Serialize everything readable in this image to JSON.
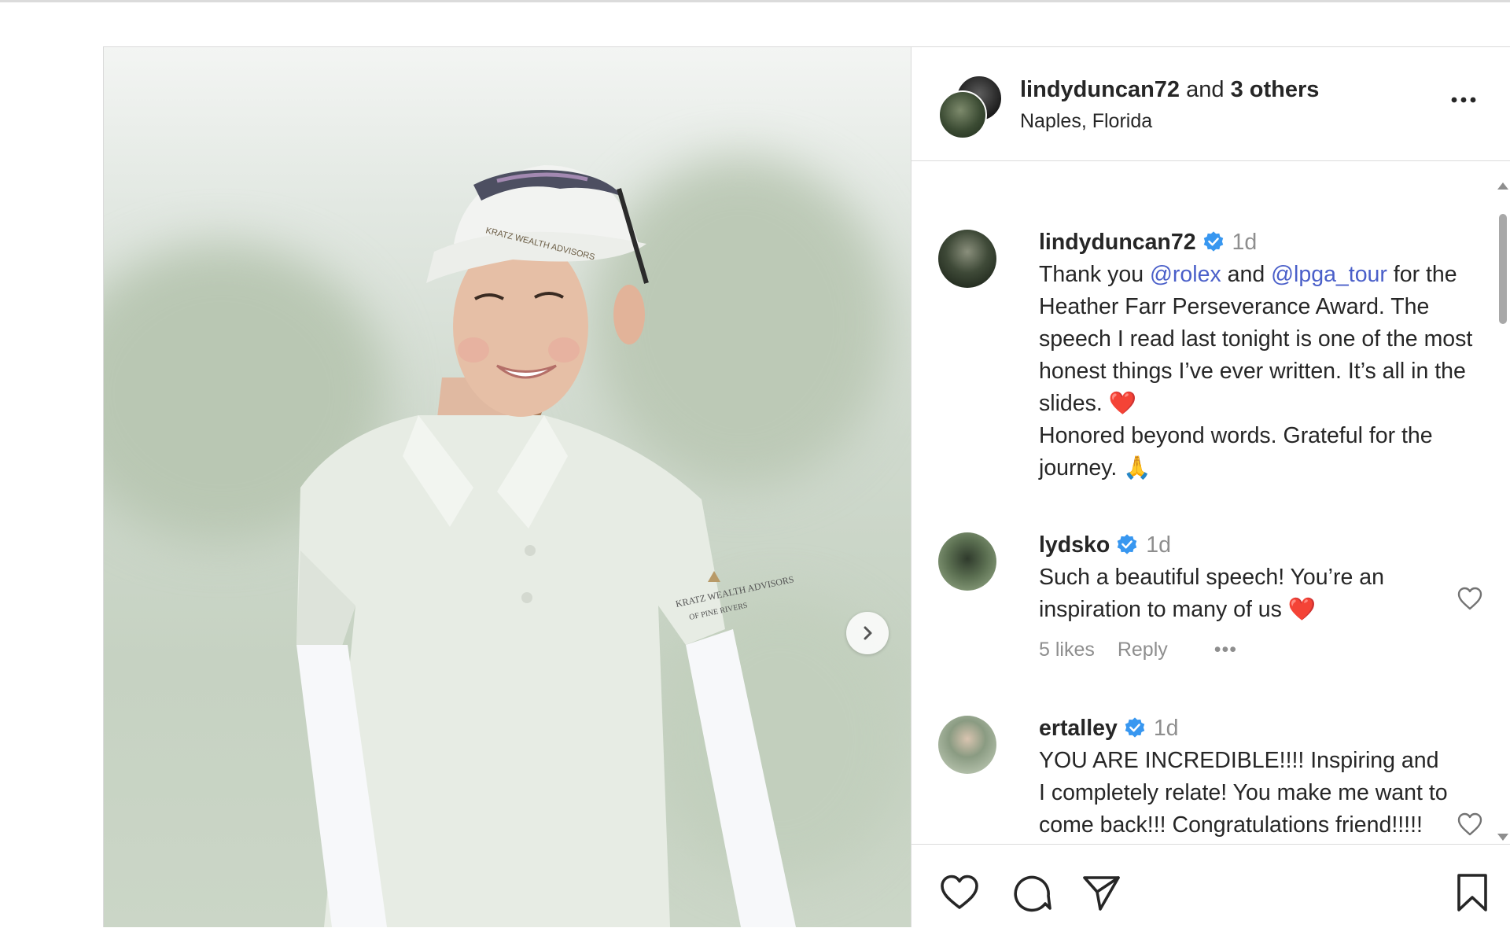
{
  "header": {
    "username": "lindyduncan72",
    "joiner": "and",
    "others": "3 others",
    "location": "Naples, Florida"
  },
  "caption": {
    "username": "lindyduncan72",
    "time": "1d",
    "text_parts": {
      "p1": "Thank you ",
      "mention1": "@rolex",
      "p2": " and ",
      "mention2": "@lpga_tour",
      "p3": " for the Heather Farr Perseverance Award. The speech I read last tonight is one of the most honest things I’ve ever written. It’s all in the slides. ",
      "emoji1": "❤️",
      "p4": "Honored beyond words. Grateful for the journey. ",
      "emoji2": "🙏"
    }
  },
  "comments": [
    {
      "username": "lydsko",
      "time": "1d",
      "text": "Such a beautiful speech! You’re an inspiration to many of us ",
      "emoji": "❤️",
      "likes": "5 likes",
      "reply": "Reply",
      "more": "•••"
    },
    {
      "username": "ertalley",
      "time": "1d",
      "text": "YOU ARE INCREDIBLE!!!! Inspiring and I completely relate! You make me want to come back!!! Congratulations friend!!!!! Wonderful words"
    }
  ],
  "photo": {
    "cap_text": "KRATZ WEALTH ADVISORS",
    "shirt_text_1": "KRATZ WEALTH ADVISORS",
    "shirt_text_2": "OF PINE RIVERS"
  },
  "colors": {
    "verified": "#3897f0",
    "mention": "#4a5fc9",
    "heart": "#ed4956",
    "border": "#dbdbdb"
  },
  "icons": {
    "next": "chevron-right-icon",
    "more": "more-horizontal-icon",
    "like": "heart-icon",
    "comment": "comment-icon",
    "share": "paper-plane-icon",
    "save": "bookmark-icon"
  }
}
